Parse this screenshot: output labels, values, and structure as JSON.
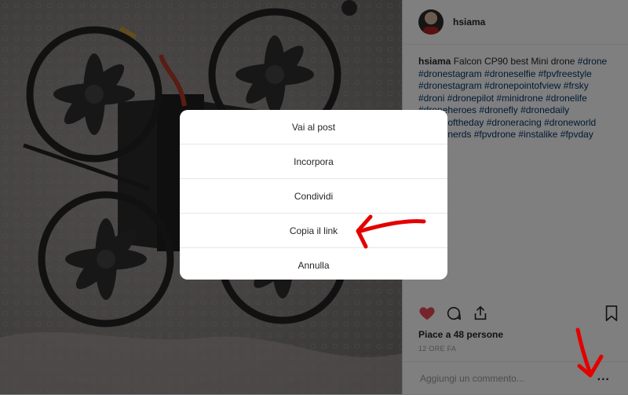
{
  "post": {
    "username": "hsiama",
    "caption_user": "hsiama",
    "caption_text": "Falcon CP90 best Mini drone",
    "hashtags": "#drone #dronestagram #droneselfie #fpvfreestyle #dronestagram #dronepointofview #frsky #droni #dronepilot #minidrone #dronelife #droneheroes #dronefly #dronedaily #droneoftheday #droneracing #droneworld #dronenerds #fpvdrone #instalike #fpvday",
    "likes": "Piace a 48 persone",
    "time": "12 ORE FA",
    "comment_placeholder": "Aggiungi un commento...",
    "more": "..."
  },
  "menu": {
    "items": [
      {
        "label": "Vai al post"
      },
      {
        "label": "Incorpora"
      },
      {
        "label": "Condividi"
      },
      {
        "label": "Copia il link"
      },
      {
        "label": "Annulla"
      }
    ]
  },
  "colors": {
    "like_red": "#ed4956",
    "annotation_red": "#e30000",
    "hashtag_blue": "#003569"
  },
  "icons": [
    "heart-icon",
    "comment-icon",
    "share-icon",
    "bookmark-icon",
    "more-icon"
  ]
}
